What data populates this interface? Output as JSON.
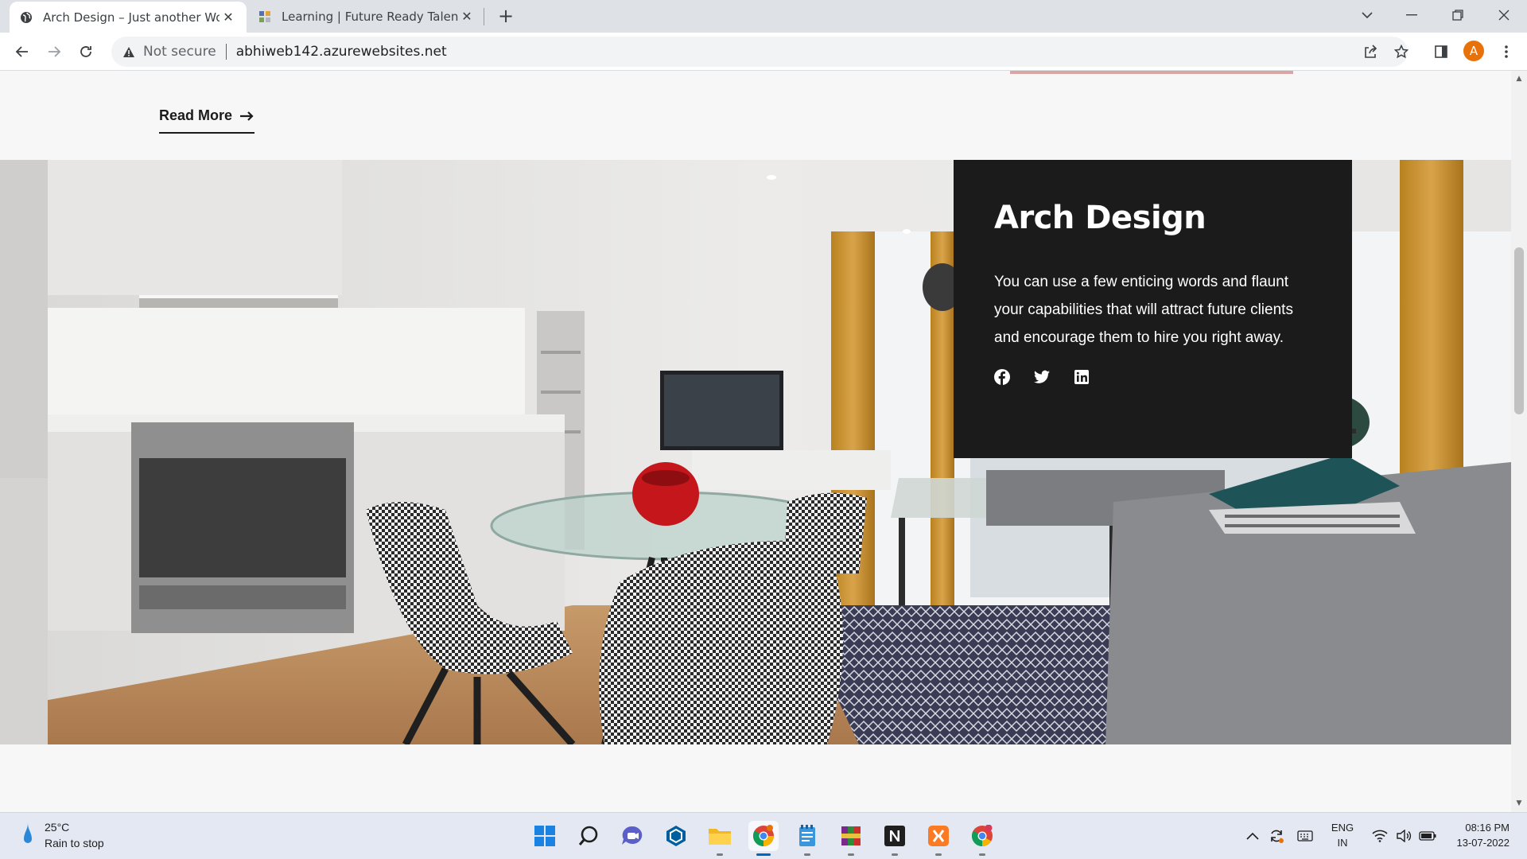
{
  "browser": {
    "tabs": [
      {
        "title": "Arch Design – Just another WordPress site",
        "active": true
      },
      {
        "title": "Learning | Future Ready Talent",
        "active": false
      }
    ],
    "security_label": "Not secure",
    "url": "abhiweb142.azurewebsites.net",
    "profile_initial": "A",
    "icons": [
      "back-arrow-icon",
      "forward-arrow-icon",
      "reload-icon",
      "warning-icon",
      "share-icon",
      "star-icon",
      "side-panel-icon",
      "menu-dots-icon"
    ]
  },
  "page": {
    "read_more_label": "Read More",
    "card": {
      "title": "Arch Design",
      "body": "You can use a few enticing words and flaunt your capabilities that will attract future clients and encourage them to hire you right away.",
      "social": [
        "facebook-icon",
        "twitter-icon",
        "linkedin-icon"
      ]
    },
    "colors": {
      "card_bg": "#1c1b1b",
      "accent_line": "#d8a7a5"
    }
  },
  "taskbar": {
    "weather_temp": "25°C",
    "weather_desc": "Rain to stop",
    "apps": [
      "windows-start-icon",
      "search-icon",
      "chat-icon",
      "sketchup-icon",
      "file-explorer-icon",
      "chrome-icon",
      "notepad-icon",
      "winrar-icon",
      "notion-icon",
      "xampp-icon",
      "chrome-profile-icon"
    ],
    "lang_top": "ENG",
    "lang_bottom": "IN",
    "time": "08:16 PM",
    "date": "13-07-2022"
  }
}
